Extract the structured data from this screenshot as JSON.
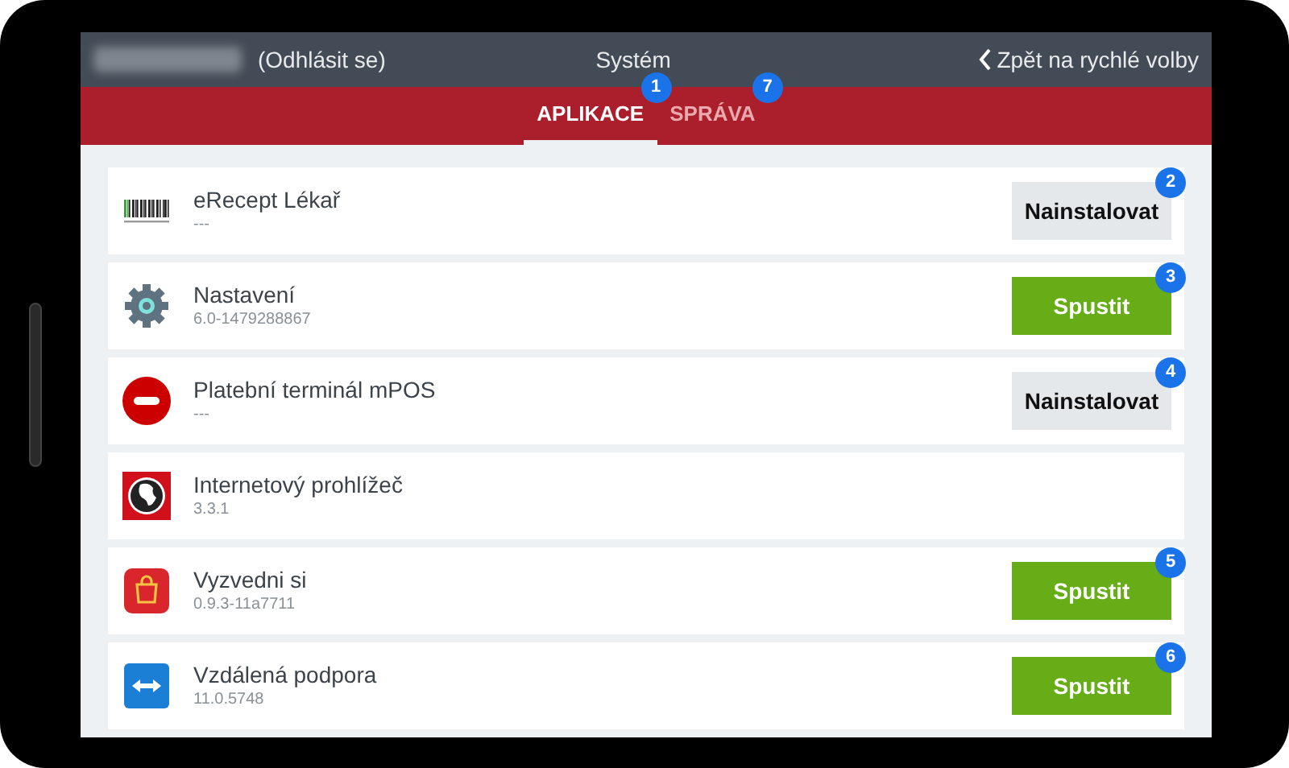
{
  "header": {
    "logout": "(Odhlásit se)",
    "title": "Systém",
    "back": "Zpět na rychlé volby"
  },
  "tabs": [
    {
      "label": "APLIKACE",
      "selected": true,
      "badge": "1"
    },
    {
      "label": "SPRÁVA",
      "selected": false,
      "badge": "7"
    }
  ],
  "apps": [
    {
      "kind": "barcode",
      "name": "eRecept Lékař",
      "version": "---",
      "action": {
        "kind": "install",
        "label": "Nainstalovat",
        "badge": "2"
      }
    },
    {
      "kind": "gear",
      "name": "Nastavení",
      "version": "6.0-1479288867",
      "action": {
        "kind": "launch",
        "label": "Spustit",
        "badge": "3"
      }
    },
    {
      "kind": "blocked",
      "name": "Platební terminál mPOS",
      "version": "---",
      "action": {
        "kind": "install",
        "label": "Nainstalovat",
        "badge": "4"
      }
    },
    {
      "kind": "globe",
      "name": "Internetový prohlížeč",
      "version": "3.3.1"
    },
    {
      "kind": "bag",
      "name": "Vyzvedni si",
      "version": "0.9.3-11a7711",
      "action": {
        "kind": "launch",
        "label": "Spustit",
        "badge": "5"
      }
    },
    {
      "kind": "remote",
      "name": "Vzdálená podpora",
      "version": "11.0.5748",
      "action": {
        "kind": "launch",
        "label": "Spustit",
        "badge": "6"
      }
    }
  ]
}
